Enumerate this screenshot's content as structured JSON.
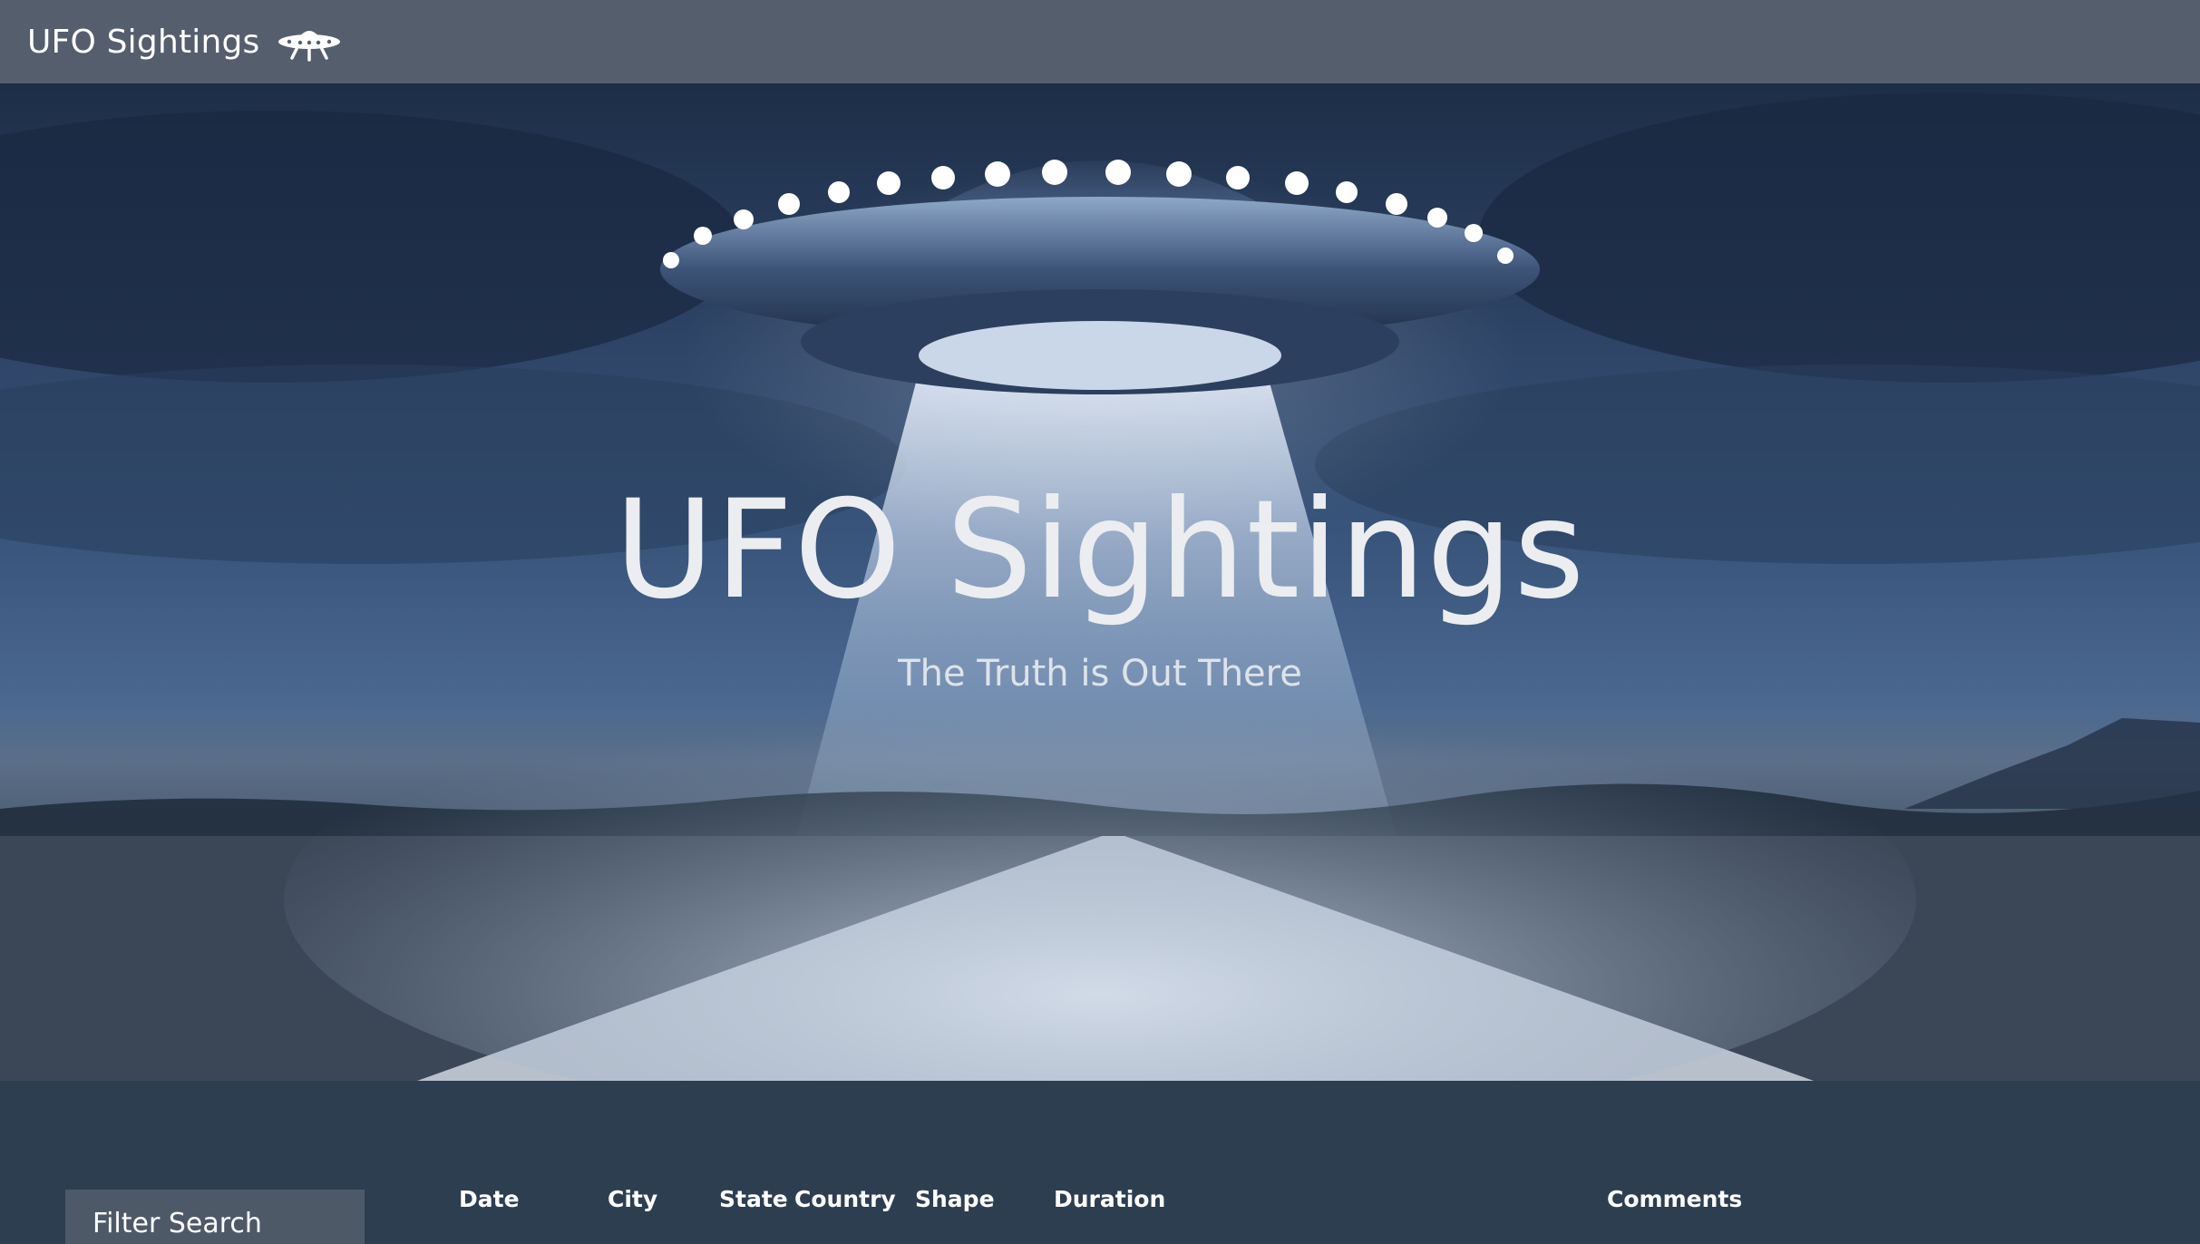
{
  "navbar": {
    "brand_text": "UFO Sightings",
    "brand_icon": "ufo-icon"
  },
  "hero": {
    "title": "UFO Sightings",
    "subtitle": "The Truth is Out There"
  },
  "filter": {
    "title": "Filter Search"
  },
  "table": {
    "columns": [
      "Date",
      "City",
      "State",
      "Country",
      "Shape",
      "Duration",
      "Comments"
    ]
  },
  "colors": {
    "navbar": "#545e6c",
    "page_bg": "#2e3e51",
    "filter_panel": "#4e5968"
  }
}
